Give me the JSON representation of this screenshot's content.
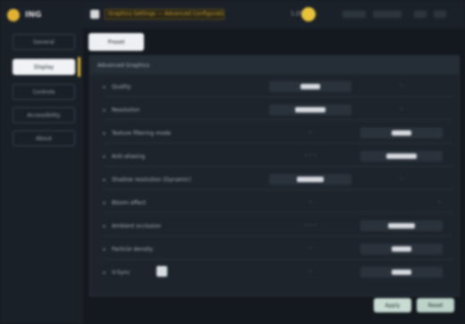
{
  "app": {
    "title": "Settings",
    "logo_text": "ING"
  },
  "sidebar": {
    "items": [
      {
        "label": "General"
      },
      {
        "label": "Display"
      },
      {
        "label": "Controls"
      },
      {
        "label": "Accessibility"
      },
      {
        "label": "About"
      }
    ],
    "active_index": 1
  },
  "topbar": {
    "title": "Graphics Settings — Advanced Configuration",
    "currency_label": "1,250"
  },
  "tab": {
    "label": "Preset"
  },
  "panel": {
    "header": "Advanced Graphics",
    "rows": [
      {
        "label": "Quality",
        "a": "High",
        "b": ""
      },
      {
        "label": "Resolution",
        "a": "1920x1080",
        "b": ""
      },
      {
        "label": "Texture filtering mode",
        "a": "",
        "b": "Anisotropic"
      },
      {
        "label": "Anti-aliasing",
        "a": "",
        "b": "TAA"
      },
      {
        "label": "Shadow resolution (Dynamic)",
        "a": "Medium",
        "b": ""
      },
      {
        "label": "Bloom effect",
        "a": "",
        "b": ""
      },
      {
        "label": "Ambient occlusion",
        "a": "",
        "b": "Ultra"
      },
      {
        "label": "Particle density",
        "a": "",
        "b": "High"
      },
      {
        "label": "V-Sync",
        "a": "",
        "b": "Enabled"
      }
    ]
  },
  "footer": {
    "apply_label": "Apply",
    "reset_label": "Reset"
  }
}
